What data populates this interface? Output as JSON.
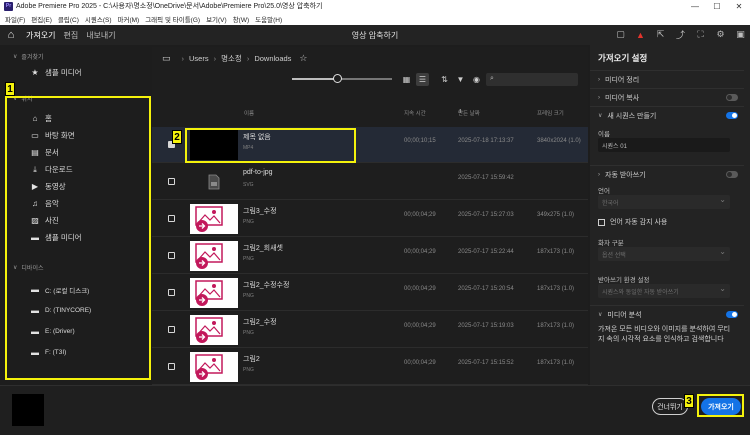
{
  "window": {
    "title": "Adobe Premiere Pro 2025 - C:\\사용자\\명소정\\OneDrive\\문서\\Adobe\\Premiere Pro\\25.0\\영상 압축하기",
    "app_icon": "Pr",
    "controls": [
      "—",
      "☐",
      "✕"
    ]
  },
  "menu": [
    "파일(F)",
    "편집(E)",
    "클립(C)",
    "시퀀스(S)",
    "마커(M)",
    "그래픽 및 타이틀(G)",
    "보기(V)",
    "창(W)",
    "도움말(H)"
  ],
  "topbar": {
    "tabs": [
      "가져오기",
      "편집",
      "내보내기"
    ],
    "active_tab": "가져오기",
    "project_title": "영상 압축하기",
    "icons": [
      "panel-icon",
      "warning-icon",
      "export-icon",
      "share-icon",
      "fullscreen-icon",
      "settings-icon",
      "workspace-icon"
    ]
  },
  "sidebar": {
    "favorites_header": "즐겨찾기",
    "favorites": [
      {
        "label": "샘플 미디어",
        "icon": "★"
      }
    ],
    "places_header": "위치",
    "places": [
      {
        "label": "홈",
        "icon": "⌂"
      },
      {
        "label": "바탕 화면",
        "icon": "▭"
      },
      {
        "label": "문서",
        "icon": "▤"
      },
      {
        "label": "다운로드",
        "icon": "⤓"
      },
      {
        "label": "동영상",
        "icon": "▶"
      },
      {
        "label": "음악",
        "icon": "♫"
      },
      {
        "label": "사진",
        "icon": "▨"
      },
      {
        "label": "샘플 미디어",
        "icon": "▬"
      }
    ],
    "devices_header": "디바이스",
    "devices": [
      {
        "label": "C: (로컬 디스크)",
        "icon": "▬"
      },
      {
        "label": "D: (TINYCORE)",
        "icon": "▬"
      },
      {
        "label": "E: (Driver)",
        "icon": "▬"
      },
      {
        "label": "F: (T3I)",
        "icon": "▬"
      }
    ]
  },
  "browser": {
    "path": [
      "Users",
      "명소정",
      "Downloads"
    ],
    "zoom_level": 0.45,
    "search_placeholder": "",
    "columns": {
      "name": "이름",
      "duration": "지속 시간",
      "date": "만든 날짜",
      "frame_size": "프레임 크기"
    },
    "date_sort_icon": "⬇",
    "files": [
      {
        "name": "제목 없음",
        "type": "MP4",
        "duration": "00;00;10;15",
        "date": "2025-07-18 17:13:37",
        "size": "3840x2024 (1.0)",
        "thumb": "black",
        "checked": true
      },
      {
        "name": "pdf-to-jpg",
        "type": "SVG",
        "duration": "",
        "date": "2025-07-17 15:59:42",
        "size": "",
        "thumb": "svg",
        "checked": false
      },
      {
        "name": "그림3_수정",
        "type": "PNG",
        "duration": "00;00;04;29",
        "date": "2025-07-17 15:27:03",
        "size": "349x275 (1.0)",
        "thumb": "pink",
        "checked": false
      },
      {
        "name": "그림2_회새셋",
        "type": "PNG",
        "duration": "00;00;04;29",
        "date": "2025-07-17 15:22:44",
        "size": "187x173 (1.0)",
        "thumb": "pink",
        "checked": false
      },
      {
        "name": "그림2_수정수정",
        "type": "PNG",
        "duration": "00;00;04;29",
        "date": "2025-07-17 15:20:54",
        "size": "187x173 (1.0)",
        "thumb": "pink",
        "checked": false
      },
      {
        "name": "그림2_수정",
        "type": "PNG",
        "duration": "00;00;04;29",
        "date": "2025-07-17 15:19:03",
        "size": "187x173 (1.0)",
        "thumb": "pink",
        "checked": false
      },
      {
        "name": "그림2",
        "type": "PNG",
        "duration": "00;00;04;29",
        "date": "2025-07-17 15:15:52",
        "size": "187x173 (1.0)",
        "thumb": "pink",
        "checked": false
      }
    ]
  },
  "settings": {
    "title": "가져오기 설정",
    "media_organize": "미디어 정리",
    "media_copy": "미디어 복사",
    "new_sequence": "새 시퀀스 만들기",
    "name_label": "이름",
    "name_value": "시퀀스 01",
    "auto_transcribe": "자동 받아쓰기",
    "language_label": "언어",
    "language_value": "한국어",
    "auto_detect_language": "언어 자동 감지 사용",
    "speaker_label": "화자 구분",
    "speaker_value": "옵션 선택",
    "transcribe_settings_label": "받아쓰기 환경 설정",
    "transcribe_settings_value": "시퀀스와 동일한 자동 받아쓰기",
    "media_analysis": "미디어 분석",
    "media_analysis_desc": "가져온 모든 비디오와 이미지를 분석하여 무티 지 속의 시각적 요소를 인식하고 검색합니다",
    "toggles": {
      "media_copy": false,
      "new_sequence": true,
      "auto_transcribe": false,
      "media_analysis": true
    }
  },
  "footer": {
    "skip_label": "건너뛰기",
    "import_label": "가져오기"
  },
  "annotations": [
    "1",
    "2",
    "3"
  ],
  "colors": {
    "accent": "#1473e6",
    "highlight": "#f4f20c",
    "warning": "#e2342c",
    "thumb_pink": "#c2185b"
  }
}
